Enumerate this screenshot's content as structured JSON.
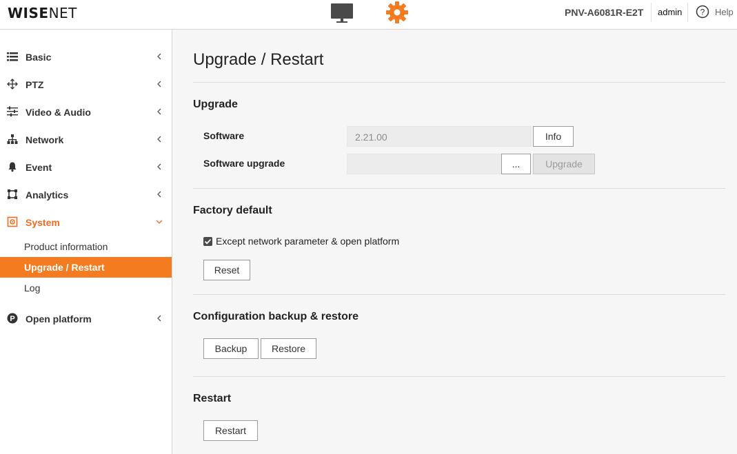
{
  "header": {
    "logo_bold": "WISE",
    "logo_light": "NET",
    "model": "PNV-A6081R-E2T",
    "user": "admin",
    "help": "Help",
    "icons": [
      "monitor-icon",
      "gear-icon",
      "help-icon"
    ],
    "accent_color": "#f47b20"
  },
  "sidebar": {
    "items": [
      {
        "label": "Basic",
        "icon": "list-icon"
      },
      {
        "label": "PTZ",
        "icon": "move-arrows-icon"
      },
      {
        "label": "Video & Audio",
        "icon": "sliders-icon"
      },
      {
        "label": "Network",
        "icon": "network-icon"
      },
      {
        "label": "Event",
        "icon": "bell-icon"
      },
      {
        "label": "Analytics",
        "icon": "analytics-icon"
      },
      {
        "label": "System",
        "icon": "system-icon",
        "expanded": true
      },
      {
        "label": "Open platform",
        "icon": "platform-p-icon"
      }
    ],
    "system_sub": [
      {
        "label": "Product information"
      },
      {
        "label": "Upgrade / Restart",
        "active": true
      },
      {
        "label": "Log"
      }
    ]
  },
  "main": {
    "title": "Upgrade / Restart",
    "upgrade": {
      "title": "Upgrade",
      "software_label": "Software",
      "software_value": "2.21.00",
      "info_button": "Info",
      "upgrade_label": "Software upgrade",
      "upgrade_value": "",
      "browse_button": "...",
      "upgrade_button": "Upgrade"
    },
    "factory": {
      "title": "Factory default",
      "checkbox_label": "Except network parameter & open platform",
      "checkbox_checked": true,
      "reset_button": "Reset"
    },
    "backup": {
      "title": "Configuration backup & restore",
      "backup_button": "Backup",
      "restore_button": "Restore"
    },
    "restart": {
      "title": "Restart",
      "restart_button": "Restart"
    }
  }
}
